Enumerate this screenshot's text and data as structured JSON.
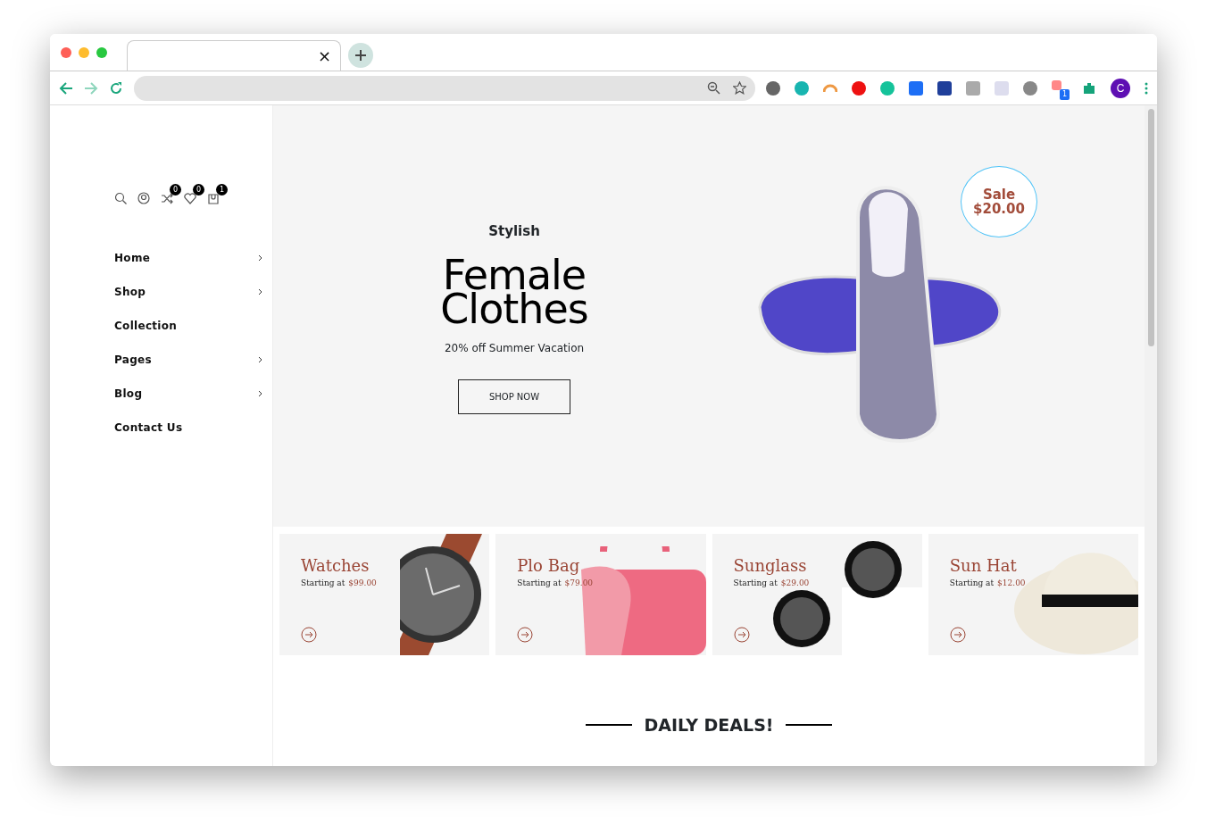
{
  "browser": {
    "tab_close": "×",
    "profile_initial": "C",
    "extension_badge": "1"
  },
  "header_icons": [
    {
      "kind": "search"
    },
    {
      "kind": "account"
    },
    {
      "kind": "compare",
      "count": "0"
    },
    {
      "kind": "wishlist",
      "count": "0"
    },
    {
      "kind": "cart",
      "count": "1"
    }
  ],
  "menu": [
    {
      "label": "Home",
      "has_submenu": true
    },
    {
      "label": "Shop",
      "has_submenu": true
    },
    {
      "label": "Collection",
      "has_submenu": false
    },
    {
      "label": "Pages",
      "has_submenu": true
    },
    {
      "label": "Blog",
      "has_submenu": true
    },
    {
      "label": "Contact Us",
      "has_submenu": false
    }
  ],
  "hero": {
    "eyebrow": "Stylish",
    "title_line_1": "Female",
    "title_line_2": "Clothes",
    "subtitle": "20% off Summer Vacation",
    "button": "SHOP NOW",
    "sale_label": "Sale",
    "sale_price": "$20.00"
  },
  "banners": [
    {
      "kind": "watch",
      "title": "Watches",
      "prefix": "Starting at",
      "price": "$99.00"
    },
    {
      "kind": "bag",
      "title": "Plo Bag",
      "prefix": "Starting at",
      "price": "$79.00"
    },
    {
      "kind": "sunglasses",
      "title": "Sunglass",
      "prefix": "Starting at",
      "price": "$29.00"
    },
    {
      "kind": "hat",
      "title": "Sun Hat",
      "prefix": "Starting at",
      "price": "$12.00"
    }
  ],
  "section_title": "DAILY DEALS!"
}
